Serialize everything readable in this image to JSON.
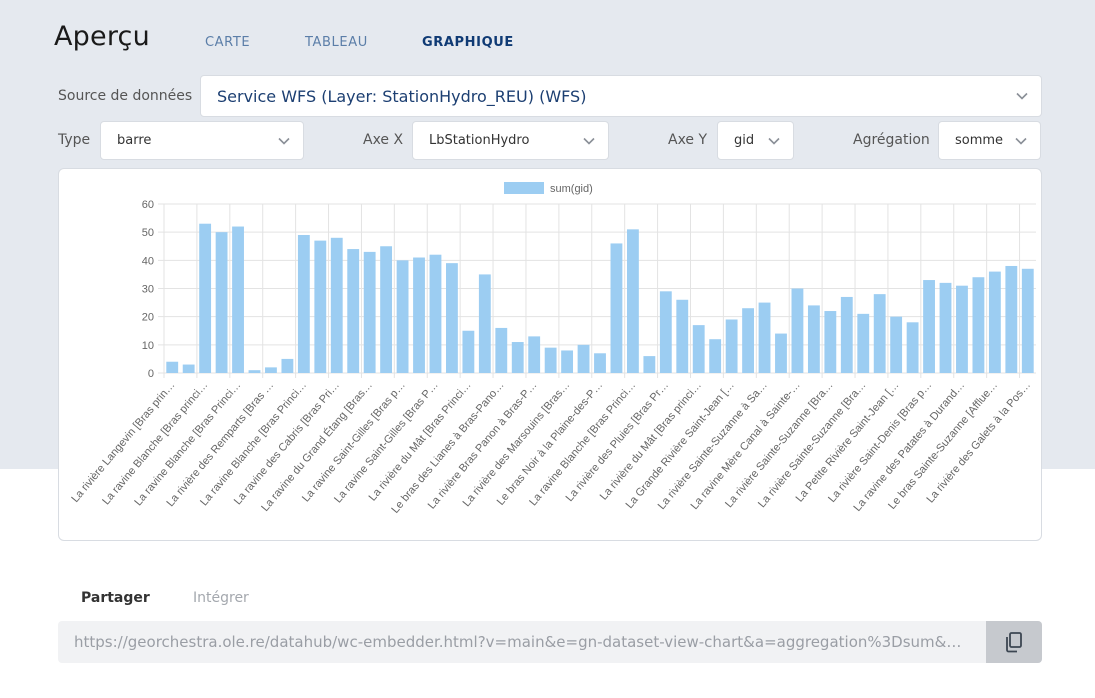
{
  "header": {
    "title": "Aperçu",
    "tabs": [
      {
        "label": "CARTE"
      },
      {
        "label": "TABLEAU"
      },
      {
        "label": "GRAPHIQUE"
      }
    ]
  },
  "controls": {
    "source_label": "Source de données",
    "source_value": "Service WFS (Layer: StationHydro_REU) (WFS)",
    "type_label": "Type",
    "type_value": "barre",
    "xaxis_label": "Axe X",
    "xaxis_value": "LbStationHydro",
    "yaxis_label": "Axe Y",
    "yaxis_value": "gid",
    "agg_label": "Agrégation",
    "agg_value": "somme"
  },
  "chart_data": {
    "type": "bar",
    "legend": "sum(gid)",
    "bar_color": "#9ccdf2",
    "ylim": [
      0,
      60
    ],
    "yticks": [
      0,
      10,
      20,
      30,
      40,
      50,
      60
    ],
    "series": [
      {
        "name": "sum(gid)",
        "values": [
          4,
          3,
          53,
          50,
          52,
          1,
          2,
          5,
          49,
          47,
          48,
          44,
          43,
          45,
          40,
          41,
          42,
          39,
          15,
          35,
          16,
          11,
          13,
          9,
          8,
          10,
          7,
          46,
          51,
          6,
          29,
          26,
          17,
          12,
          19,
          23,
          25,
          14,
          30,
          24,
          22,
          27,
          21,
          28,
          20,
          18,
          33,
          32,
          31,
          34,
          36,
          38,
          37
        ]
      }
    ],
    "tick_labels": [
      "La rivière Langevin [Bras prin…",
      "La ravine Blanche [Bras princi…",
      "La ravine Blanche [Bras Princi…",
      "La rivière des Remparts [Bras …",
      "La ravine Blanche [Bras Princi…",
      "La ravine des Cabris [Bras Pri…",
      "La ravine du Grand Étang [Bras…",
      "La ravine Saint-Gilles [Bras p…",
      "La ravine Saint-Gilles [Bras P…",
      "La rivière du Mât [Bras Princi…",
      "Le bras des Lianes à Bras-Pano…",
      "La rivière Bras Panon à Bras-P…",
      "La rivière des Marsouins [Bras…",
      "Le bras Noir à la Plaine-des-P…",
      "La ravine Blanche [Bras Princi…",
      "La rivière des Pluies [Bras Pr…",
      "La rivière du Mât [Bras princi…",
      "La Grande Rivière Saint-Jean […",
      "La rivière Sainte-Suzanne à Sa…",
      "La ravine Mère Canal à Sainte-…",
      "La rivière Sainte-Suzanne [Bra…",
      "La rivière Sainte-Suzanne [Bra…",
      "La Petite Rivière Saint-Jean […",
      "La rivière Saint-Denis [Bras p…",
      "La ravine des Patates à Durand…",
      "Le bras Sainte-Suzanne [Afflue…",
      "La rivière des Galets à la Pos…"
    ]
  },
  "share": {
    "tab_share": "Partager",
    "tab_embed": "Intégrer",
    "url": "https://georchestra.ole.re/datahub/wc-embedder.html?v=main&e=gn-dataset-view-chart&a=aggregation%3Dsum&…"
  }
}
